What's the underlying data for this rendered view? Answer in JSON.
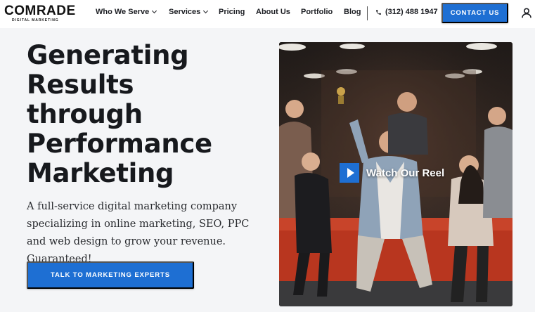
{
  "brand": {
    "name": "COMRADE",
    "tagline": "DIGITAL MARKETING",
    "accent": "#1e6fd3"
  },
  "nav": {
    "items": [
      {
        "label": "Who We Serve",
        "dropdown": true
      },
      {
        "label": "Services",
        "dropdown": true
      },
      {
        "label": "Pricing",
        "dropdown": false
      },
      {
        "label": "About Us",
        "dropdown": false
      },
      {
        "label": "Portfolio",
        "dropdown": false
      },
      {
        "label": "Blog",
        "dropdown": false
      }
    ],
    "phone": "(312) 488 1947",
    "contact_label": "CONTACT US"
  },
  "hero": {
    "title_lines": [
      "Generating",
      "Results",
      "through",
      "Performance",
      "Marketing"
    ],
    "subtitle": "A full-service digital marketing company specializing in online marketing, SEO, PPC and web design to grow your revenue. Guaranteed!",
    "cta_label": "TALK TO MARKETING EXPERTS"
  },
  "video": {
    "reel_label": "Watch Our Reel"
  },
  "icons": [
    "chevron-down-icon",
    "phone-icon",
    "user-icon",
    "play-icon"
  ]
}
